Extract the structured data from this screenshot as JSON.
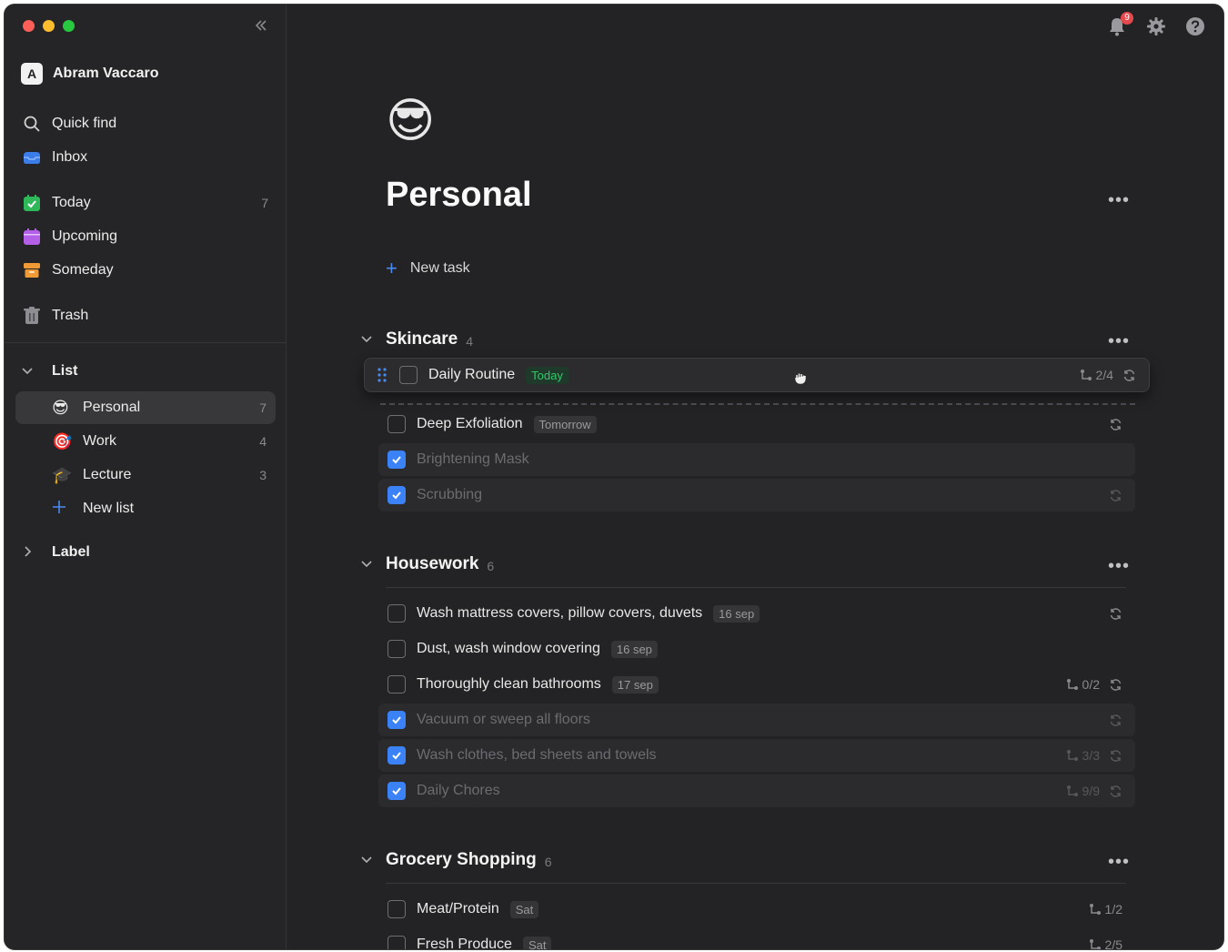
{
  "sidebar": {
    "user": {
      "initial": "A",
      "name": "Abram Vaccaro"
    },
    "nav": [
      {
        "label": "Quick find",
        "icon": "search-icon"
      },
      {
        "label": "Inbox",
        "icon": "inbox-icon"
      },
      {
        "label": "Today",
        "icon": "calendar-check-icon",
        "count": "7"
      },
      {
        "label": "Upcoming",
        "icon": "calendar-icon"
      },
      {
        "label": "Someday",
        "icon": "archive-box-icon"
      },
      {
        "label": "Trash",
        "icon": "trash-icon"
      }
    ],
    "list_section": {
      "label": "List"
    },
    "lists": [
      {
        "label": "Personal",
        "emoji": "😎",
        "count": "7"
      },
      {
        "label": "Work",
        "emoji": "🎯",
        "count": "4"
      },
      {
        "label": "Lecture",
        "emoji": "🎓",
        "count": "3"
      }
    ],
    "new_list_label": "New list",
    "label_section": {
      "label": "Label"
    }
  },
  "topbar": {
    "notification_count": "9"
  },
  "page": {
    "emoji": "😎",
    "title": "Personal",
    "new_task_label": "New task"
  },
  "groups": [
    {
      "title": "Skincare",
      "count": "4",
      "dragging_task": {
        "title": "Daily Routine",
        "tag": "Today",
        "subtasks": "2/4"
      },
      "tasks": [
        {
          "title": "Deep Exfoliation",
          "tag": "Tomorrow",
          "done": false
        },
        {
          "title": "Brightening Mask",
          "done": true
        },
        {
          "title": "Scrubbing",
          "done": true
        }
      ]
    },
    {
      "title": "Housework",
      "count": "6",
      "tasks": [
        {
          "title": "Wash mattress covers, pillow covers, duvets",
          "tag": "16 sep",
          "done": false
        },
        {
          "title": "Dust, wash window covering",
          "tag": "16 sep",
          "done": false
        },
        {
          "title": "Thoroughly clean bathrooms",
          "tag": "17 sep",
          "subtasks": "0/2",
          "done": false
        },
        {
          "title": "Vacuum or sweep all floors",
          "done": true
        },
        {
          "title": "Wash clothes, bed sheets and towels",
          "subtasks": "3/3",
          "done": true
        },
        {
          "title": "Daily Chores",
          "subtasks": "9/9",
          "done": true
        }
      ]
    },
    {
      "title": "Grocery Shopping",
      "count": "6",
      "tasks": [
        {
          "title": "Meat/Protein",
          "tag": "Sat",
          "subtasks": "1/2",
          "done": false
        },
        {
          "title": "Fresh Produce",
          "tag": "Sat",
          "subtasks": "2/5",
          "done": false
        }
      ]
    }
  ],
  "colors": {
    "accent": "#3b82f6",
    "today_tag": "#34c76a",
    "badge": "#e5484d"
  }
}
